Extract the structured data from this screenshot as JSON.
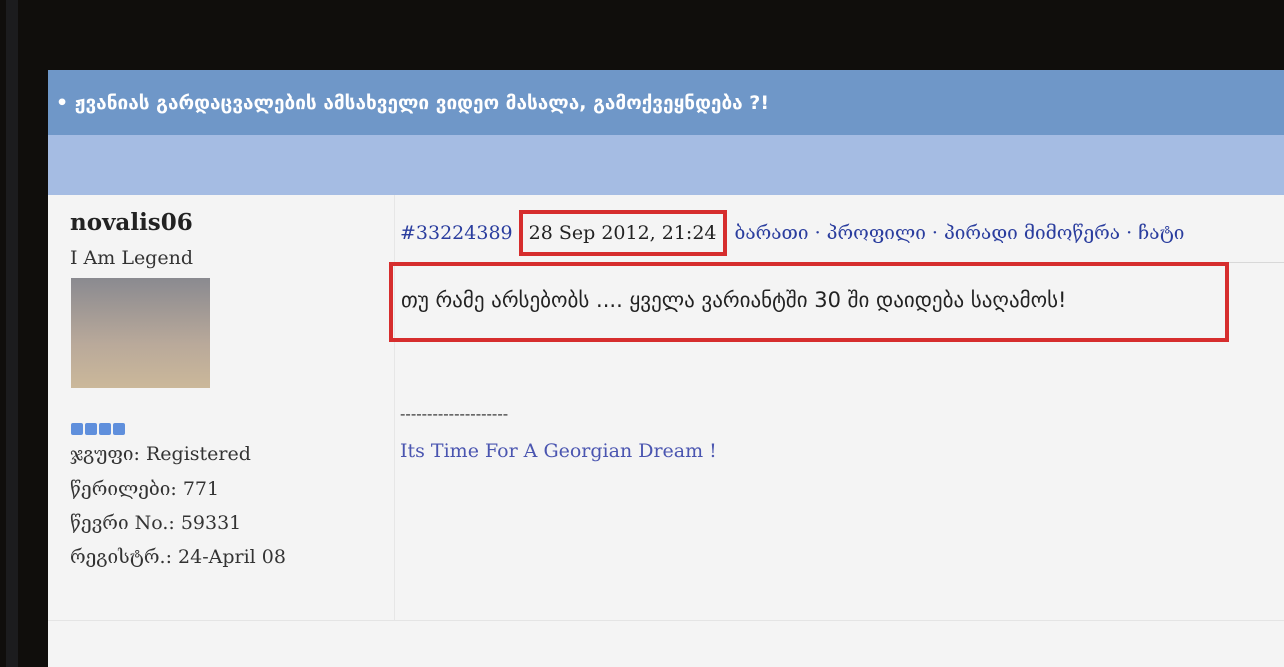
{
  "topic": {
    "title": "ჟვანიას გარდაცვალების ამსახველი ვიდეო მასალა, გამოქვეყნდება ?!"
  },
  "user": {
    "name": "novalis06",
    "title": "I Am Legend",
    "group": "ჯგუფი: Registered",
    "posts": "წერილები: 771",
    "member_no": "წევრი No.: 59331",
    "registered": "რეგისტრ.: 24-April 08"
  },
  "post": {
    "id": "#33224389",
    "date": "28 Sep 2012, 21:24",
    "links": "ბარათი · პროფილი · პირადი მიმოწერა · ჩატი",
    "body": "თუ რამე არსებობს .... ყველა ვარიანტში 30 ში დაიდება საღამოს!",
    "sig_sep": "--------------------",
    "signature": "Its Time For A Georgian Dream !"
  },
  "colors": {
    "title_bar": "#6f97c8",
    "sub_bar": "#a5bce3",
    "highlight": "#d62d2d"
  }
}
